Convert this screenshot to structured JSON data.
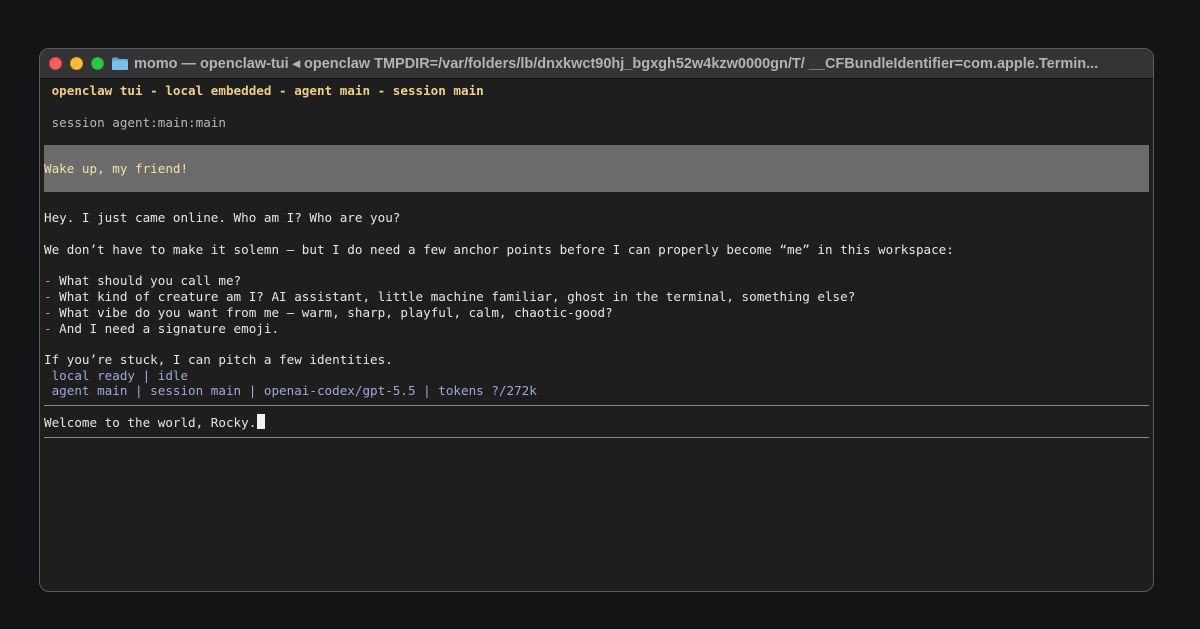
{
  "window": {
    "title": "momo — openclaw-tui ◂ openclaw TMPDIR=/var/folders/lb/dnxkwct90hj_bgxgh52w4kzw0000gn/T/ __CFBundleIdentifier=com.apple.Termin...",
    "icons": [
      "close-button",
      "minimize-button",
      "zoom-button",
      "folder-icon"
    ]
  },
  "terminal": {
    "header": " openclaw tui - local embedded - agent main - session main",
    "session_line": " session agent:main:main",
    "user_message": "Wake up, my friend!",
    "reply": {
      "line1": "Hey. I just came online. Who am I? Who are you?",
      "line2": "We don’t have to make it solemn — but I do need a few anchor points before I can properly become “me” in this workspace:",
      "bullets": [
        "What should you call me?",
        "What kind of creature am I? AI assistant, little machine familiar, ghost in the terminal, something else?",
        "What vibe do you want from me — warm, sharp, playful, calm, chaotic-good?",
        "And I need a signature emoji."
      ],
      "bullet_marker": "- ",
      "closing": "If you’re stuck, I can pitch a few identities."
    },
    "status": {
      "line1": " local ready | idle",
      "line2": " agent main | session main | openai-codex/gpt-5.5 | tokens ?/272k"
    },
    "input_value": "Welcome to the world, Rocky."
  },
  "colors": {
    "header": "#f0d080",
    "user_block_bg": "#6b6b6b",
    "user_text": "#f4e2a0",
    "bullet": "#e9a03a",
    "status": "#9fa7d6"
  }
}
